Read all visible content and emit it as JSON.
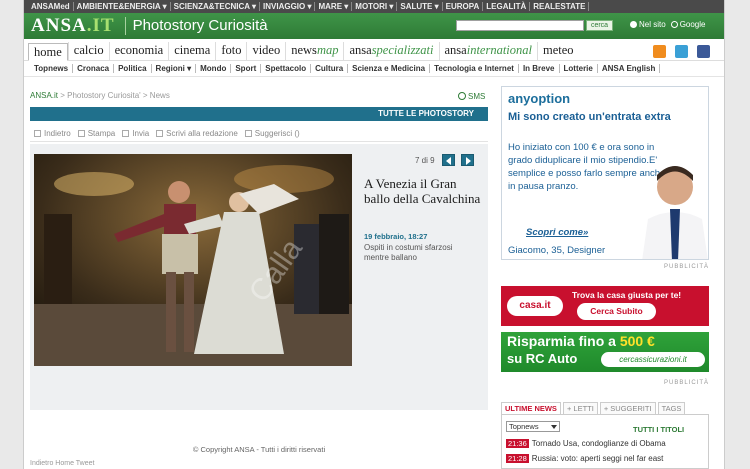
{
  "topbar": {
    "items": [
      "ANSAMed",
      "AMBIENTE&ENERGIA ▾",
      "SCIENZA&TECNICA ▾",
      "INVIAGGIO ▾",
      "MARE ▾",
      "MOTORI ▾",
      "SALUTE ▾",
      "EUROPA",
      "LEGALITÀ",
      "REALESTATE"
    ]
  },
  "header": {
    "logo_main": "ANSA",
    "logo_suffix": ".IT",
    "section_title": "Photostory Curiosità",
    "search_button": "cerca",
    "radio_site": "Nel sito",
    "radio_google": "Google"
  },
  "nav": {
    "tabs": [
      "home",
      "calcio",
      "economia",
      "cinema",
      "foto",
      "video",
      "news",
      "ansa",
      "ansa",
      "meteo"
    ],
    "tabs_em": [
      "",
      "",
      "",
      "",
      "",
      "",
      "map",
      "specializzati",
      "international",
      ""
    ]
  },
  "subnav": {
    "items": [
      "Topnews",
      "Cronaca",
      "Politica",
      "Regioni ▾",
      "Mondo",
      "Sport",
      "Spettacolo",
      "Cultura",
      "Scienza e Medicina",
      "Tecnologia e Internet",
      "In Breve",
      "Lotterie",
      "ANSA English"
    ]
  },
  "breadcrumb": {
    "home": "ANSA.it",
    "rest": " > Photostory Curiosita' > News"
  },
  "sms": "SMS",
  "bluebar": "TUTTE LE PHOTOSTORY",
  "toolbar": [
    "Indietro",
    "Stampa",
    "Invia",
    "Scrivi alla redazione",
    "Suggerisci ()"
  ],
  "gallery": {
    "counter": "7 di 9",
    "headline": "A Venezia il Gran ballo della Cavalchina",
    "date": "19 febbraio, 18:27",
    "caption": "Ospiti in costumi sfarzosi mentre ballano",
    "watermark": "Calla"
  },
  "copyright": "© Copyright ANSA - Tutti i diritti riservati",
  "bottombar": "Indietro   Home   Tweet",
  "ad1": {
    "logo": "anyoption",
    "headline": "Mi sono creato un'entrata extra",
    "body": "Ho iniziato con 100 € e ora sono in grado diduplicare il mio stipendio.E' semplice e posso farlo sempre anche in pausa pranzo.",
    "link": "Scopri come»",
    "signature": "Giacomo, 35, Designer"
  },
  "pub_label": "PUBBLICITÀ",
  "ad2": {
    "logo": "casa.it",
    "title": "Trova la casa giusta per te!",
    "button": "Cerca Subito"
  },
  "ad3": {
    "line1a": "Risparmia fino a ",
    "line1b": "500 €",
    "line2": "su RC Auto",
    "logo": "cercassicurazioni.it"
  },
  "news_tabs": [
    "ULTIME NEWS",
    "+ LETTI",
    "+ SUGGERITI",
    "TAGS"
  ],
  "news": {
    "select": "Topnews",
    "all_titles": "TUTTI I TITOLI",
    "rows": [
      {
        "time": "21:36",
        "text": "Tornado Usa, condoglianze di Obama"
      },
      {
        "time": "21:28",
        "text": "Russia: voto: aperti seggi nel far east"
      }
    ]
  },
  "colors": {
    "ansa_green": "#3f9448",
    "blue": "#20708c",
    "red": "#c8102e"
  }
}
